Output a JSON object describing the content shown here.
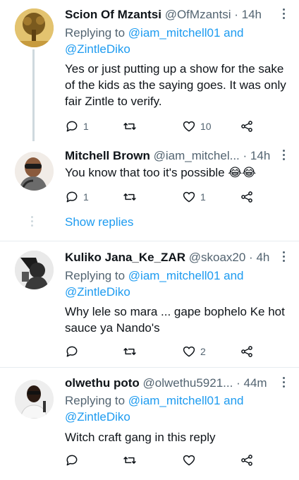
{
  "tweets": [
    {
      "name": "Scion Of Mzantsi",
      "handle": "@OfMzantsi",
      "dot": "·",
      "time": "14h",
      "replying_prefix": "Replying to ",
      "replying_to_1": "@iam_mitchell01",
      "replying_and": " and",
      "replying_to_2": "@ZintleDiko",
      "text": "Yes or just putting up a show for the sake of the kids as the saying goes. It was only fair Zintle to verify.",
      "replies": "1",
      "retweets": "",
      "likes": "10"
    },
    {
      "name": "Mitchell Brown",
      "handle": "@iam_mitchel...",
      "dot": "·",
      "time": "14h",
      "text": "You know that too it's possible 😂😂",
      "replies": "1",
      "retweets": "",
      "likes": "1",
      "show_replies": "Show replies"
    },
    {
      "name": "Kuliko Jana_Ke_ZAR",
      "handle": "@skoax20",
      "dot": "·",
      "time": "4h",
      "replying_prefix": "Replying to ",
      "replying_to_1": "@iam_mitchell01",
      "replying_and": " and",
      "replying_to_2": "@ZintleDiko",
      "text": "Why lele so mara ... gape bophelo Ke hot sauce ya Nando's",
      "replies": "",
      "retweets": "",
      "likes": "2"
    },
    {
      "name": "olwethu poto",
      "handle": "@olwethu5921...",
      "dot": "·",
      "time": "44m",
      "replying_prefix": "Replying to ",
      "replying_to_1": "@iam_mitchell01",
      "replying_and": " and",
      "replying_to_2": "@ZintleDiko",
      "text": "Witch craft gang in this reply",
      "replies": "",
      "retweets": "",
      "likes": ""
    }
  ],
  "icons": {
    "reply": "reply-icon",
    "retweet": "retweet-icon",
    "like": "heart-icon",
    "share": "share-icon",
    "more": "more-icon"
  },
  "colors": {
    "link": "#1d9bf0",
    "muted": "#536471",
    "text": "#0f1419",
    "divider": "#e6ecf0"
  }
}
